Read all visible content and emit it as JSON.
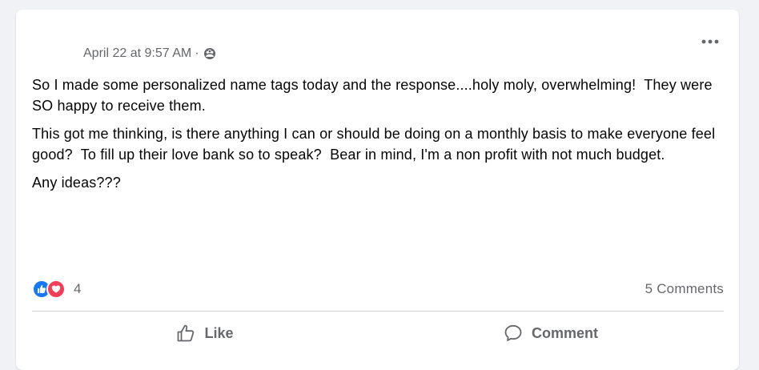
{
  "post": {
    "timestamp": "April 22 at 9:57 AM",
    "separator": "·",
    "audience_icon": "group-audience-icon",
    "more_icon": "more-options-icon",
    "paragraphs": [
      "So I made some personalized name tags today and the response....holy moly, overwhelming!  They were SO happy to receive them.",
      "This got me thinking, is there anything I can or should be doing on a monthly basis to make everyone feel good?  To fill up their love bank so to speak?  Bear in mind, I'm a non profit with not much budget.",
      "Any ideas???"
    ]
  },
  "reactions": {
    "types": [
      "like",
      "love"
    ],
    "count": "4",
    "colors": {
      "like": "#1877f2",
      "love": "#f33e58"
    }
  },
  "comments": {
    "label": "5 Comments"
  },
  "actions": {
    "like_label": "Like",
    "like_icon": "thumbs-up-outline-icon",
    "comment_label": "Comment",
    "comment_icon": "speech-bubble-icon"
  }
}
